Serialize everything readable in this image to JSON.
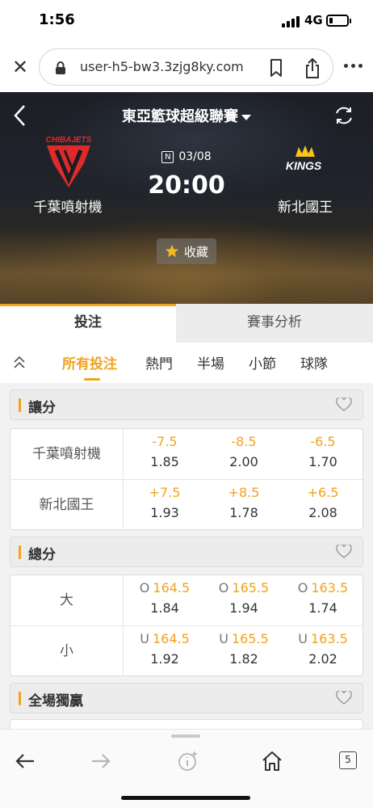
{
  "status_bar": {
    "time": "1:56",
    "network": "4G",
    "battery_level": 0.2
  },
  "browser": {
    "url": "user-h5-bw3.3zjg8ky.com",
    "tab_count": "5"
  },
  "match": {
    "league": "東亞籃球超級聯賽",
    "home_team": "千葉噴射機",
    "home_logo_text": "CHIBAJETS",
    "away_team": "新北國王",
    "away_logo_text": "KINGS",
    "date_badge": "N",
    "date": "03/08",
    "time": "20:00",
    "favorite_label": "收藏"
  },
  "main_tabs": {
    "betting": "投注",
    "analysis": "賽事分析"
  },
  "sub_tabs": {
    "all": "所有投注",
    "popular": "熱門",
    "half": "半場",
    "quarter": "小節",
    "team": "球隊"
  },
  "markets": {
    "handicap": {
      "title": "讓分",
      "rows": [
        {
          "label": "千葉噴射機",
          "odds": [
            {
              "line": "-7.5",
              "price": "1.85"
            },
            {
              "line": "-8.5",
              "price": "2.00"
            },
            {
              "line": "-6.5",
              "price": "1.70"
            }
          ]
        },
        {
          "label": "新北國王",
          "odds": [
            {
              "line": "+7.5",
              "price": "1.93"
            },
            {
              "line": "+8.5",
              "price": "1.78"
            },
            {
              "line": "+6.5",
              "price": "2.08"
            }
          ]
        }
      ]
    },
    "totals": {
      "title": "總分",
      "rows": [
        {
          "label": "大",
          "odds": [
            {
              "prefix": "O",
              "line": "164.5",
              "price": "1.84"
            },
            {
              "prefix": "O",
              "line": "165.5",
              "price": "1.94"
            },
            {
              "prefix": "O",
              "line": "163.5",
              "price": "1.74"
            }
          ]
        },
        {
          "label": "小",
          "odds": [
            {
              "prefix": "U",
              "line": "164.5",
              "price": "1.92"
            },
            {
              "prefix": "U",
              "line": "165.5",
              "price": "1.82"
            },
            {
              "prefix": "U",
              "line": "163.5",
              "price": "2.02"
            }
          ]
        }
      ]
    },
    "moneyline": {
      "title": "全場獨贏"
    }
  },
  "colors": {
    "accent": "#f0a31d",
    "home_brand": "#e02a2a",
    "away_brand": "#f5c518"
  }
}
